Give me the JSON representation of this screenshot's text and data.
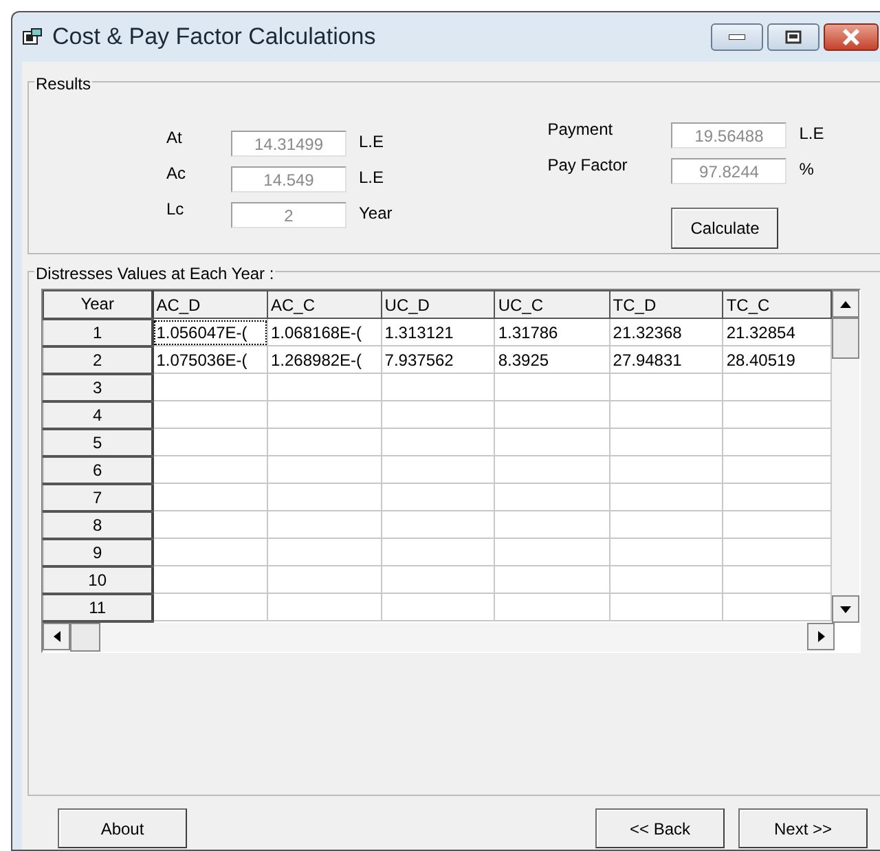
{
  "window": {
    "title": "Cost & Pay Factor Calculations"
  },
  "results": {
    "title": "Results",
    "left_fields": [
      {
        "label": "At",
        "value": "14.31499",
        "unit": "L.E",
        "disabled": true
      },
      {
        "label": "Ac",
        "value": "14.549",
        "unit": "L.E",
        "disabled": true
      },
      {
        "label": "Lc",
        "value": "2",
        "unit": "Year",
        "disabled": true
      }
    ],
    "right_fields": [
      {
        "label": "Payment",
        "value": "19.56488",
        "unit": "L.E",
        "disabled": true
      },
      {
        "label": "Pay Factor",
        "value": "97.8244",
        "unit": "%",
        "disabled": true
      }
    ],
    "calculate_button": {
      "label": "Calculate"
    }
  },
  "distresses": {
    "title": "Distresses Values at Each Year :",
    "columns": [
      "Year",
      "AC_D",
      "AC_C",
      "UC_D",
      "UC_C",
      "TC_D",
      "TC_C"
    ],
    "rows": [
      {
        "year": "1",
        "cells": [
          {
            "text": "1.056047E-(",
            "focused": true
          },
          {
            "text": "1.068168E-(",
            "focused": false
          },
          {
            "text": "1.313121",
            "focused": false
          },
          {
            "text": "1.31786",
            "focused": false
          },
          {
            "text": "21.32368",
            "focused": false
          },
          {
            "text": "21.32854",
            "focused": false
          }
        ]
      },
      {
        "year": "2",
        "cells": [
          {
            "text": "1.075036E-(",
            "focused": false
          },
          {
            "text": "1.268982E-(",
            "focused": false
          },
          {
            "text": "7.937562",
            "focused": false
          },
          {
            "text": "8.3925",
            "focused": false
          },
          {
            "text": "27.94831",
            "focused": false
          },
          {
            "text": "28.40519",
            "focused": false
          }
        ]
      },
      {
        "year": "3"
      },
      {
        "year": "4"
      },
      {
        "year": "5"
      },
      {
        "year": "6"
      },
      {
        "year": "7"
      },
      {
        "year": "8"
      },
      {
        "year": "9"
      },
      {
        "year": "10"
      },
      {
        "year": "11"
      }
    ]
  },
  "buttons": [
    {
      "label": "About",
      "kind": "left"
    },
    {
      "label": "<< Back",
      "kind": "right"
    },
    {
      "label": "Next >>",
      "kind": "right"
    }
  ]
}
